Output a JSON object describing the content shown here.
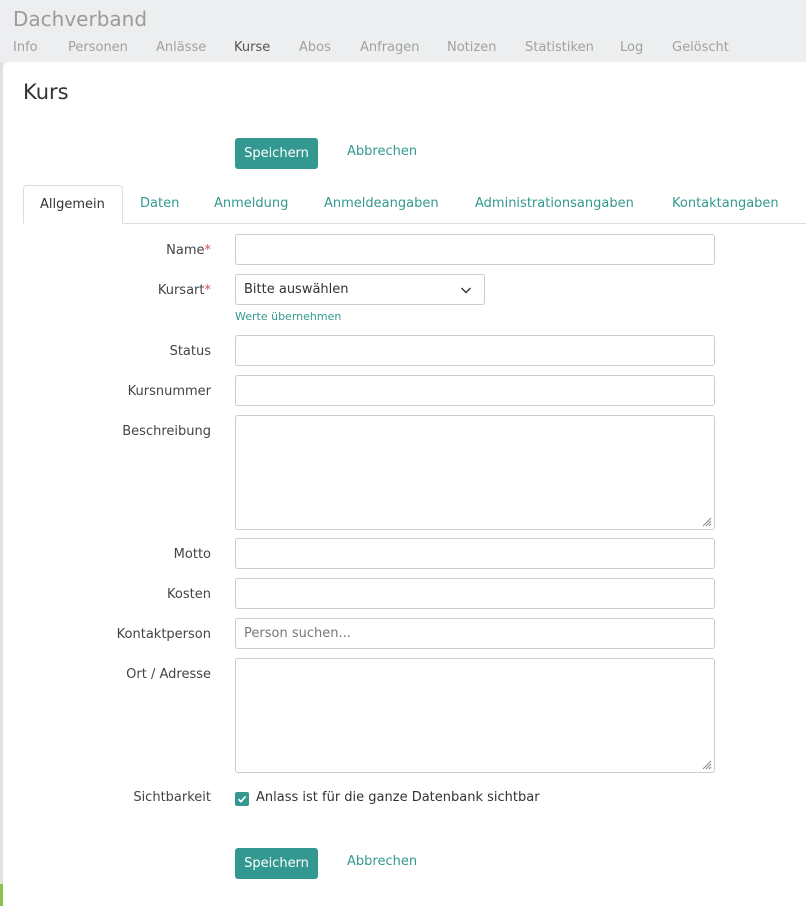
{
  "header": {
    "group_title": "Dachverband",
    "nav": [
      {
        "label": "Info",
        "active": false
      },
      {
        "label": "Personen",
        "active": false
      },
      {
        "label": "Anlässe",
        "active": false
      },
      {
        "label": "Kurse",
        "active": true
      },
      {
        "label": "Abos",
        "active": false
      },
      {
        "label": "Anfragen",
        "active": false
      },
      {
        "label": "Notizen",
        "active": false
      },
      {
        "label": "Statistiken",
        "active": false
      },
      {
        "label": "Log",
        "active": false
      },
      {
        "label": "Gelöscht",
        "active": false
      }
    ]
  },
  "page": {
    "title": "Kurs",
    "save_label": "Speichern",
    "cancel_label": "Abbrechen"
  },
  "tabs": [
    {
      "label": "Allgemein",
      "active": true
    },
    {
      "label": "Daten",
      "active": false
    },
    {
      "label": "Anmeldung",
      "active": false
    },
    {
      "label": "Anmeldeangaben",
      "active": false
    },
    {
      "label": "Administrationsangaben",
      "active": false
    },
    {
      "label": "Kontaktangaben",
      "active": false
    }
  ],
  "form": {
    "name": {
      "label": "Name",
      "required_mark": "*",
      "value": ""
    },
    "kursart": {
      "label": "Kursart",
      "required_mark": "*",
      "selected": "Bitte auswählen",
      "help_link": "Werte übernehmen"
    },
    "status": {
      "label": "Status",
      "value": ""
    },
    "kursnummer": {
      "label": "Kursnummer",
      "value": ""
    },
    "beschreibung": {
      "label": "Beschreibung",
      "value": ""
    },
    "motto": {
      "label": "Motto",
      "value": ""
    },
    "kosten": {
      "label": "Kosten",
      "value": ""
    },
    "kontaktperson": {
      "label": "Kontaktperson",
      "value": "",
      "placeholder": "Person suchen..."
    },
    "ort": {
      "label": "Ort / Adresse",
      "value": ""
    },
    "sichtbarkeit": {
      "label": "Sichtbarkeit",
      "checkbox_label": "Anlass ist für die ganze Datenbank sichtbar",
      "checked": true
    }
  },
  "colors": {
    "accent": "#339990",
    "required": "#d9534f",
    "muted_text": "#a1a1a1"
  }
}
